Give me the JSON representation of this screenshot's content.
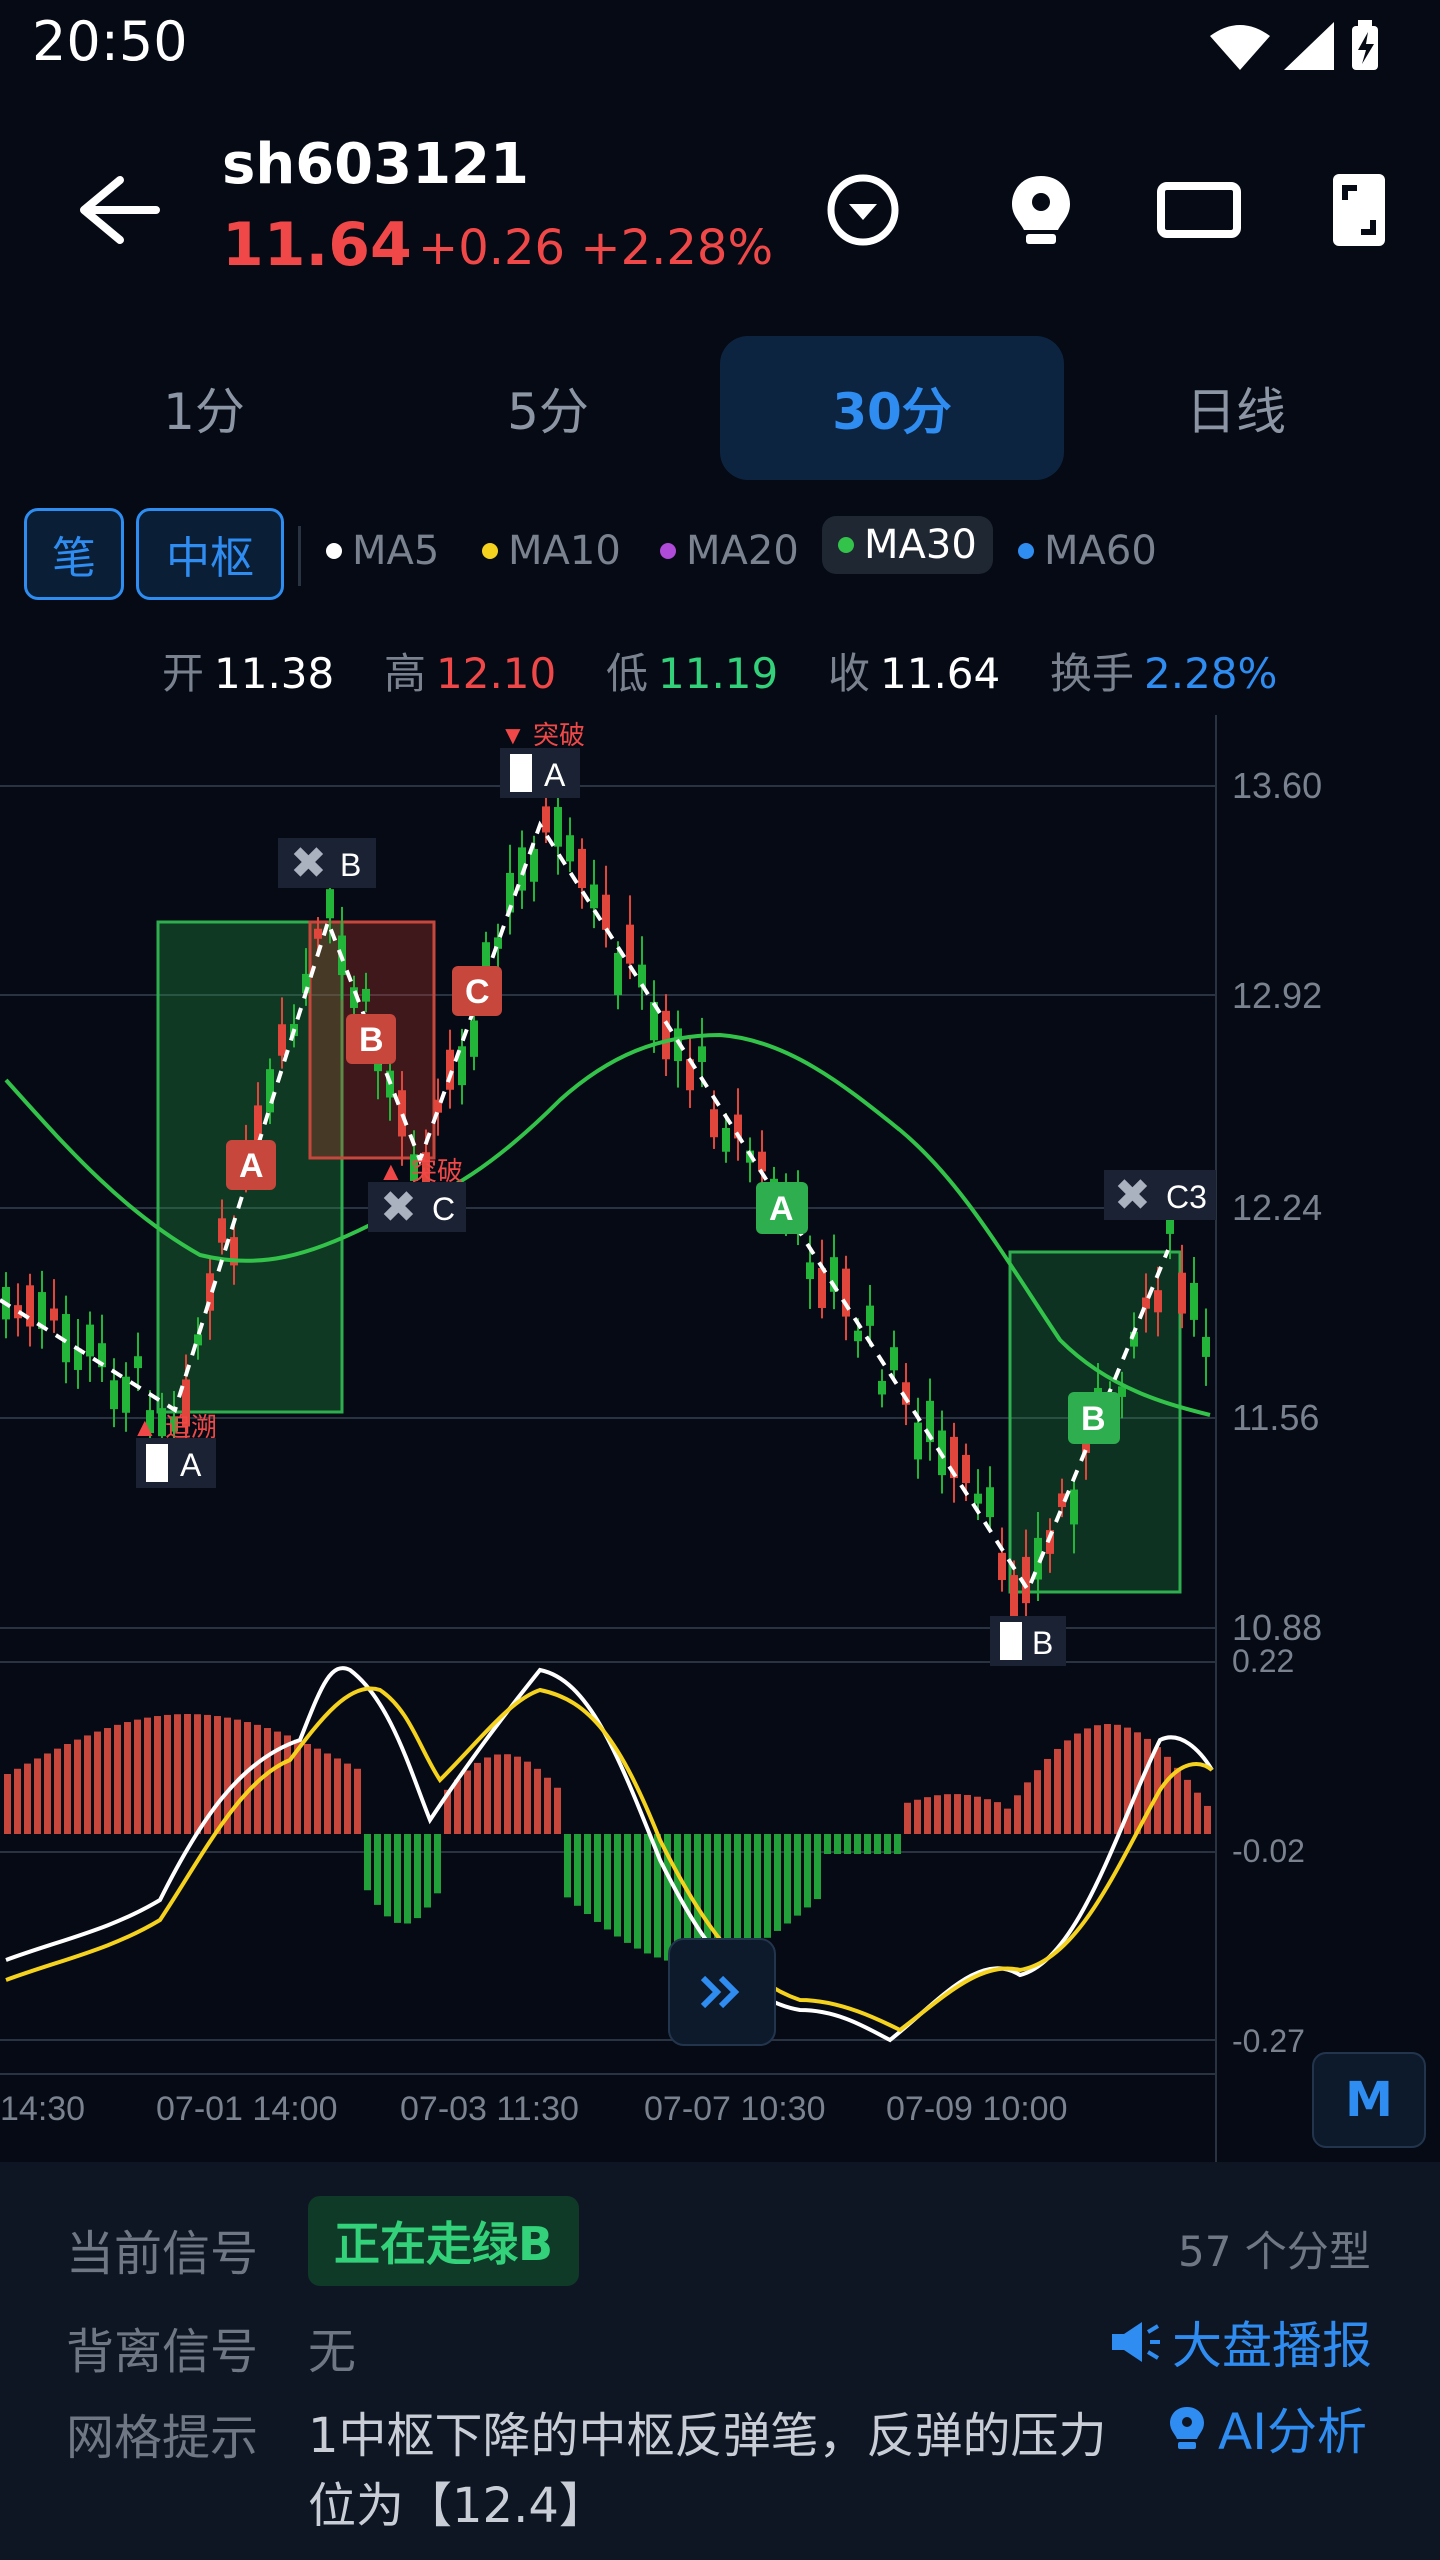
{
  "status_bar": {
    "time": "20:50"
  },
  "header": {
    "code": "sh603121",
    "price": "11.64",
    "change": "+0.26 +2.28%"
  },
  "tabs": [
    {
      "label": "1分"
    },
    {
      "label": "5分"
    },
    {
      "label": "30分",
      "active": true
    },
    {
      "label": "日线"
    }
  ],
  "toolbar": {
    "chips": [
      "笔",
      "中枢"
    ],
    "ma": [
      {
        "label": "MA5",
        "color": "#ffffff"
      },
      {
        "label": "MA10",
        "color": "#f5d21e"
      },
      {
        "label": "MA20",
        "color": "#b04ad8"
      },
      {
        "label": "MA30",
        "color": "#33c24a",
        "active": true
      },
      {
        "label": "MA60",
        "color": "#2f8cf0"
      }
    ]
  },
  "ohlc": {
    "open_label": "开",
    "open": "11.38",
    "high_label": "高",
    "high": "12.10",
    "low_label": "低",
    "low": "11.19",
    "close_label": "收",
    "close": "11.64",
    "turnover_label": "换手",
    "turnover": "2.28%"
  },
  "chart_data": {
    "type": "candlestick",
    "price_axis": [
      "13.60",
      "12.92",
      "12.24",
      "11.56",
      "10.88"
    ],
    "macd_axis": [
      "0.22",
      "-0.02",
      "-0.27"
    ],
    "time_axis": [
      "14:30",
      "07-01 14:00",
      "07-03 11:30",
      "07-07 10:30",
      "07-09 10:00"
    ],
    "annotations": [
      {
        "label": "追溯",
        "marker": "A"
      },
      {
        "label": "突破",
        "marker": "C"
      },
      {
        "label": "突破",
        "marker": "A"
      },
      {
        "marker": "B"
      },
      {
        "marker": "B"
      },
      {
        "marker": "C3"
      }
    ],
    "stroke_labels": [
      "A",
      "B",
      "C",
      "A",
      "B"
    ],
    "ma30_color": "#33c24a",
    "dif_color": "#ffffff",
    "dea_color": "#f5d21e",
    "up_color": "#e0463c",
    "down_color": "#22b53a"
  },
  "chart_labels": {
    "retrace": "追溯",
    "break1": "突破",
    "break2": "突破",
    "mA1": "A",
    "mB1": "B",
    "mC1": "C",
    "mA2": "A",
    "mB2": "B",
    "mC3": "C3",
    "sA1": "A",
    "sB1": "B",
    "sC1": "C",
    "sA2": "A",
    "sB2": "B"
  },
  "buttons": {
    "m": "M"
  },
  "panel": {
    "current_signal_label": "当前信号",
    "current_signal": "正在走绿B",
    "fractal_count": "57 个分型",
    "divergence_label": "背离信号",
    "divergence": "无",
    "broadcast": "大盘播报",
    "grid_label": "网格提示",
    "grid_text_1": "1中枢下降的中枢反弹笔，反弹的压力",
    "grid_text_2": "位为【12.4】",
    "ai": "AI分析"
  }
}
